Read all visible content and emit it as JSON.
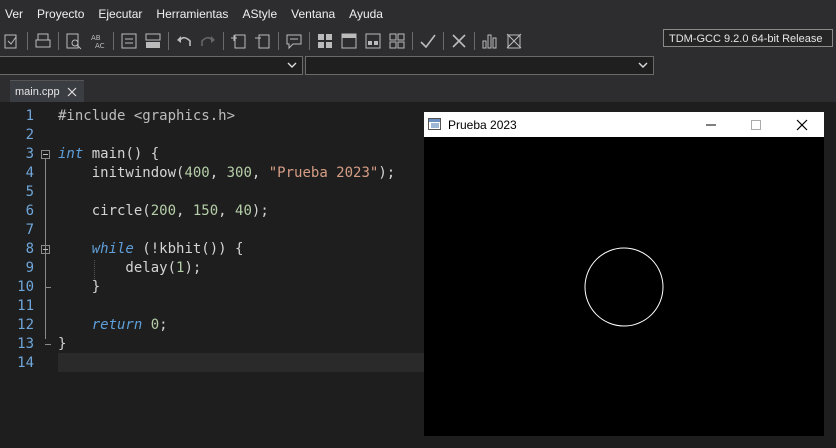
{
  "menu": {
    "items": [
      "Ver",
      "Proyecto",
      "Ejecutar",
      "Herramientas",
      "AStyle",
      "Ventana",
      "Ayuda"
    ]
  },
  "toolbar": {
    "compiler": "TDM-GCC 9.2.0 64-bit Release"
  },
  "tabs": [
    {
      "label": "main.cpp"
    }
  ],
  "editor": {
    "line_numbers": [
      "1",
      "2",
      "3",
      "4",
      "5",
      "6",
      "7",
      "8",
      "9",
      "10",
      "11",
      "12",
      "13",
      "14"
    ],
    "tokens": {
      "l1": "#include <graphics.h>",
      "l3_kw": "int",
      "l3_rest": " main() {",
      "l4_a": "    initwindow(",
      "l4_n1": "400",
      "l4_c1": ", ",
      "l4_n2": "300",
      "l4_c2": ", ",
      "l4_s": "\"Prueba 2023\"",
      "l4_end": ");",
      "l6_a": "    circle(",
      "l6_n1": "200",
      "l6_c1": ", ",
      "l6_n2": "150",
      "l6_c2": ", ",
      "l6_n3": "40",
      "l6_end": ");",
      "l8_pre": "    ",
      "l8_kw": "while",
      "l8_rest": " (!kbhit()) {",
      "l9_a": "        delay(",
      "l9_n": "1",
      "l9_end": ");",
      "l10": "    }",
      "l12_pre": "    ",
      "l12_kw": "return",
      "l12_sp": " ",
      "l12_n": "0",
      "l12_end": ";",
      "l13": "}"
    }
  },
  "graphics_window": {
    "title": "Prueba 2023"
  },
  "colors": {
    "keyword": "#5f9fd9",
    "number": "#b5cea8",
    "string": "#d69d85",
    "line_number": "#6fa6d9"
  }
}
